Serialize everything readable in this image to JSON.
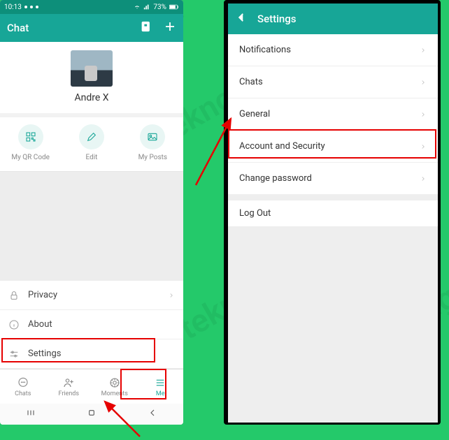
{
  "watermark": "teknoding.com",
  "left": {
    "status": {
      "time": "10:13",
      "battery": "73%"
    },
    "header": {
      "title": "Chat"
    },
    "profile": {
      "name": "Andre X"
    },
    "actions": {
      "qr": "My QR Code",
      "edit": "Edit",
      "posts": "My Posts"
    },
    "menu": {
      "privacy": "Privacy",
      "about": "About",
      "settings": "Settings"
    },
    "tabs": {
      "chats": "Chats",
      "friends": "Friends",
      "moments": "Moments",
      "me": "Me"
    }
  },
  "right": {
    "header": {
      "title": "Settings"
    },
    "items": {
      "notifications": "Notifications",
      "chats": "Chats",
      "general": "General",
      "account_security": "Account and Security",
      "change_password": "Change password",
      "logout": "Log Out"
    }
  }
}
